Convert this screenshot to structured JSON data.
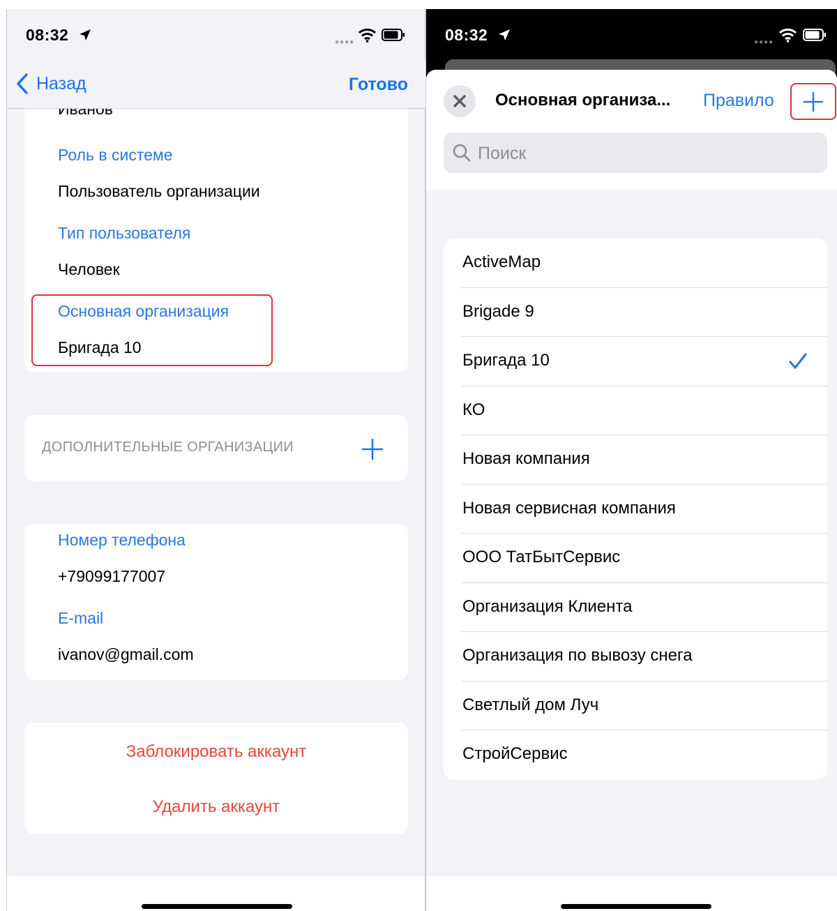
{
  "left_screen": {
    "status_time": "08:32",
    "nav": {
      "back_label": "Назад",
      "done_label": "Готово"
    },
    "profile": {
      "clipped_text": "Иванов",
      "role_label": "Роль в системе",
      "role_value": "Пользователь организации",
      "type_label": "Тип пользователя",
      "type_value": "Человек",
      "org_label": "Основная организация",
      "org_value": "Бригада 10"
    },
    "additional_orgs": {
      "title": "ДОПОЛНИТЕЛЬНЫЕ ОРГАНИЗАЦИИ"
    },
    "contacts": {
      "phone_label": "Номер телефона",
      "phone_value": "+79099177007",
      "email_label": "E-mail",
      "email_value": "ivanov@gmail.com"
    },
    "actions": {
      "block_label": "Заблокировать аккаунт",
      "delete_label": "Удалить аккаунт"
    }
  },
  "right_screen": {
    "status_time": "08:32",
    "sheet": {
      "title": "Основная организа...",
      "edit_label": "Правило",
      "search_placeholder": "Поиск"
    },
    "organizations": [
      {
        "name": "ActiveMap",
        "selected": false
      },
      {
        "name": "Brigade 9",
        "selected": false
      },
      {
        "name": "Бригада 10",
        "selected": true
      },
      {
        "name": "КО",
        "selected": false
      },
      {
        "name": "Новая компания",
        "selected": false
      },
      {
        "name": "Новая сервисная компания",
        "selected": false
      },
      {
        "name": "ООО ТатБытСервис",
        "selected": false
      },
      {
        "name": "Организация Клиента",
        "selected": false
      },
      {
        "name": "Организация по вывозу снега",
        "selected": false
      },
      {
        "name": "Светлый дом Луч",
        "selected": false
      },
      {
        "name": "СтройСервис",
        "selected": false
      }
    ]
  },
  "colors": {
    "accent": "#2a77dd",
    "danger": "#e5473b",
    "highlight": "#e0303a",
    "grouped_bg": "#f2f2f7"
  }
}
